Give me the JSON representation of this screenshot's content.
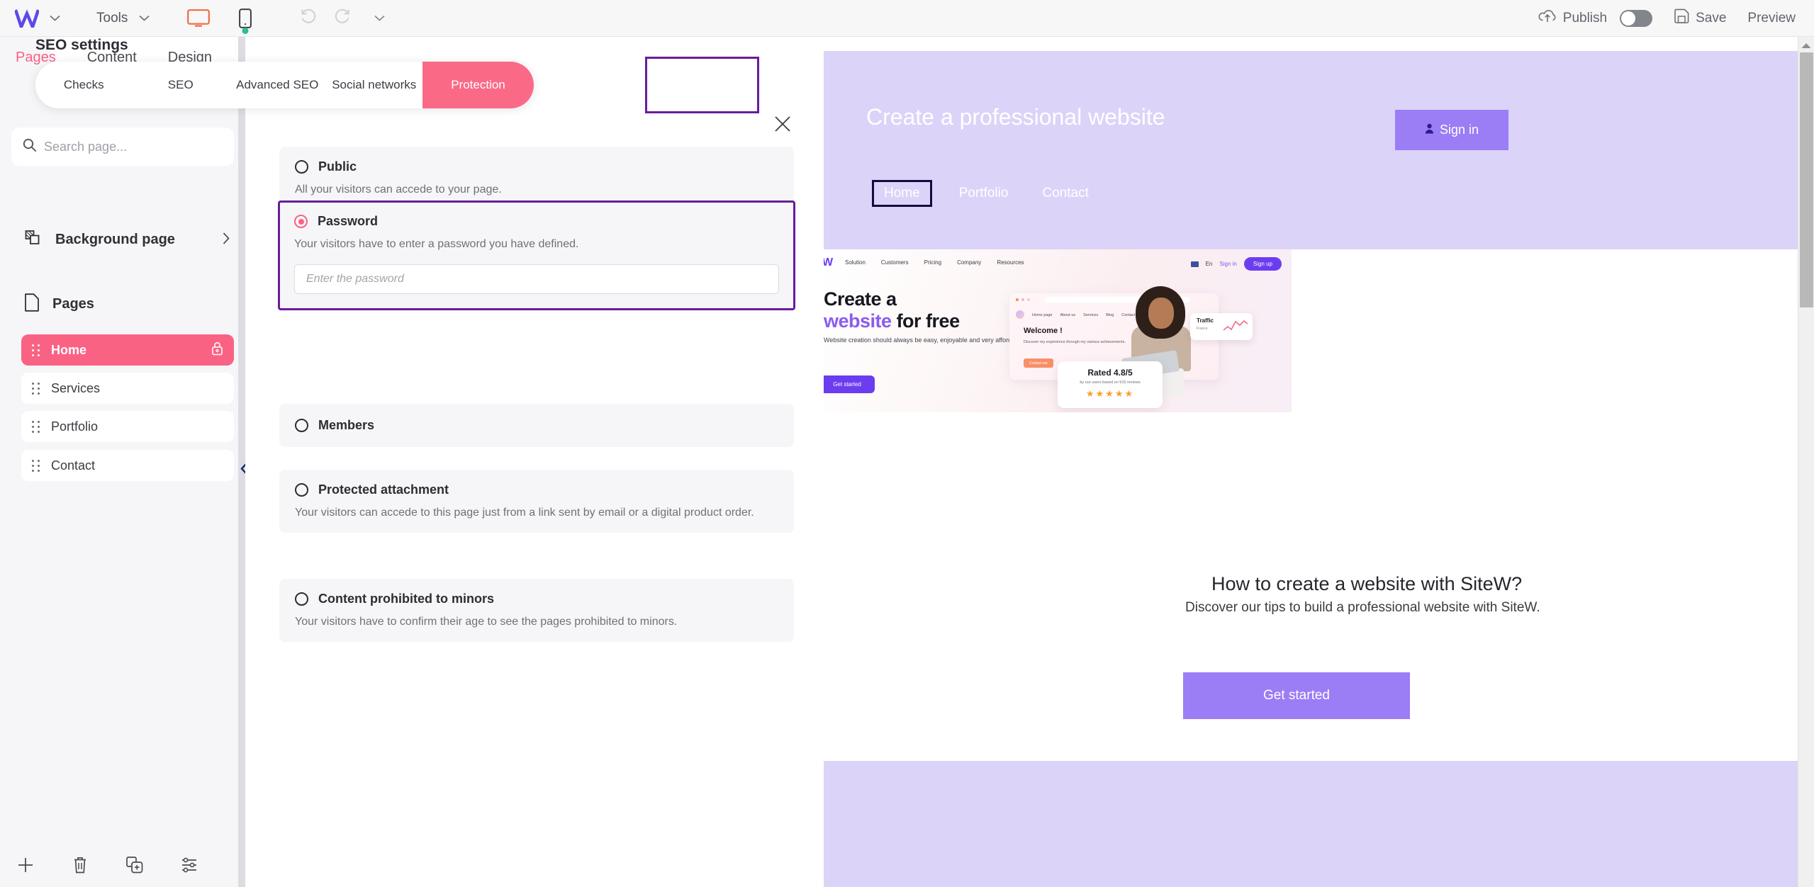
{
  "topbar": {
    "logo": "W",
    "logo_caret": "chevron-down",
    "tools_label": "Tools",
    "tools_caret": "chevron-down",
    "desktop_icon": "monitor-icon",
    "mobile_icon": "mobile-icon",
    "undo_icon": "undo-icon",
    "redo_icon": "redo-icon",
    "history_caret": "chevron-down",
    "publish_label": "Publish",
    "publish_icon": "cloud-upload-icon",
    "publish_toggle_state": "off",
    "save_label": "Save",
    "save_icon": "floppy-disk-icon",
    "preview_label": "Preview"
  },
  "sidebar": {
    "tabs": [
      {
        "label": "Pages",
        "active": true
      },
      {
        "label": "Content",
        "active": false
      },
      {
        "label": "Design",
        "active": false
      }
    ],
    "search": {
      "placeholder": "Search page...",
      "value": "",
      "icon": "search-icon"
    },
    "background_page": {
      "label": "Background page",
      "icon": "layers-icon",
      "chevron": "chevron-right"
    },
    "pages_header": {
      "label": "Pages",
      "icon": "page-icon"
    },
    "pages": [
      {
        "label": "Home",
        "active": true,
        "locked": true
      },
      {
        "label": "Services",
        "active": false,
        "locked": false
      },
      {
        "label": "Portfolio",
        "active": false,
        "locked": false
      },
      {
        "label": "Contact",
        "active": false,
        "locked": false
      }
    ],
    "bottom_actions": [
      {
        "icon": "plus-icon",
        "name": "add-page"
      },
      {
        "icon": "trash-icon",
        "name": "delete-page"
      },
      {
        "icon": "duplicate-icon",
        "name": "duplicate-page"
      },
      {
        "icon": "sliders-icon",
        "name": "page-settings"
      }
    ],
    "collapse_icon": "chevron-left"
  },
  "modal": {
    "title": "SEO settings",
    "close_icon": "close-icon",
    "tabs": [
      {
        "label": "Checks",
        "active": false
      },
      {
        "label": "SEO",
        "active": false
      },
      {
        "label": "Advanced SEO",
        "active": false
      },
      {
        "label": "Social networks",
        "active": false
      },
      {
        "label": "Protection",
        "active": true
      }
    ],
    "highlight_color": "#6a1b9a",
    "accent_color": "#fa6a87",
    "options": [
      {
        "title": "Public",
        "description": "All your visitors can accede to your page.",
        "selected": false
      },
      {
        "title": "Password",
        "description": "Your visitors have to enter a password you have defined.",
        "selected": true,
        "input_placeholder": "Enter the password",
        "input_value": "",
        "highlighted": true
      },
      {
        "title": "Members",
        "description": "",
        "selected": false
      },
      {
        "title": "Protected attachment",
        "description": "Your visitors can accede to this page just from a link sent by email or a digital product order.",
        "selected": false
      },
      {
        "title": "Content prohibited to minors",
        "description": "Your visitors have to confirm their age to see the pages prohibited to minors.",
        "selected": false
      }
    ]
  },
  "preview": {
    "hero": {
      "title": "Create a professional website",
      "signin_label": "Sign in",
      "signin_icon": "user-icon",
      "nav": [
        {
          "label": "Home",
          "active": true
        },
        {
          "label": "Portfolio",
          "active": false
        },
        {
          "label": "Contact",
          "active": false
        }
      ]
    },
    "embedded_shot": {
      "logo": "W",
      "nav": [
        "Solution",
        "Customers",
        "Pricing",
        "Company",
        "Resources"
      ],
      "lang": "En",
      "signin": "Sign in",
      "signup": "Sign up",
      "headline_line1": "Create a",
      "headline_word": "website",
      "headline_rest": "for free",
      "subtext": "Website creation should always be easy, enjoyable and very affordable. Welcome to SiteW.",
      "cta": "Get started",
      "inner_nav": [
        "Home page",
        "About us",
        "Services",
        "Blog",
        "Contact"
      ],
      "inner_welcome": "Welcome !",
      "inner_text": "Discover my experience through my various achievements.",
      "inner_btn": "Contact me",
      "traffic_title": "Traffic",
      "traffic_sub": "France",
      "rated_title": "Rated 4.8/5",
      "rated_sub": "by our users based on 915 reviews",
      "stars": "★★★★★"
    },
    "section2": {
      "title": "How to create a website with SiteW?",
      "subtitle": "Discover our tips to build a professional website with SiteW.",
      "cta_label": "Get started"
    },
    "scrollbar": {
      "arrow_icon": "triangle-up-icon"
    }
  },
  "colors": {
    "pink": "#fa6284",
    "purple_highlight": "#6a1b9a",
    "hero_band": "#dcd3f9",
    "cta_purple": "#9b7df5",
    "sidebar_bg": "#f6f6f8"
  }
}
